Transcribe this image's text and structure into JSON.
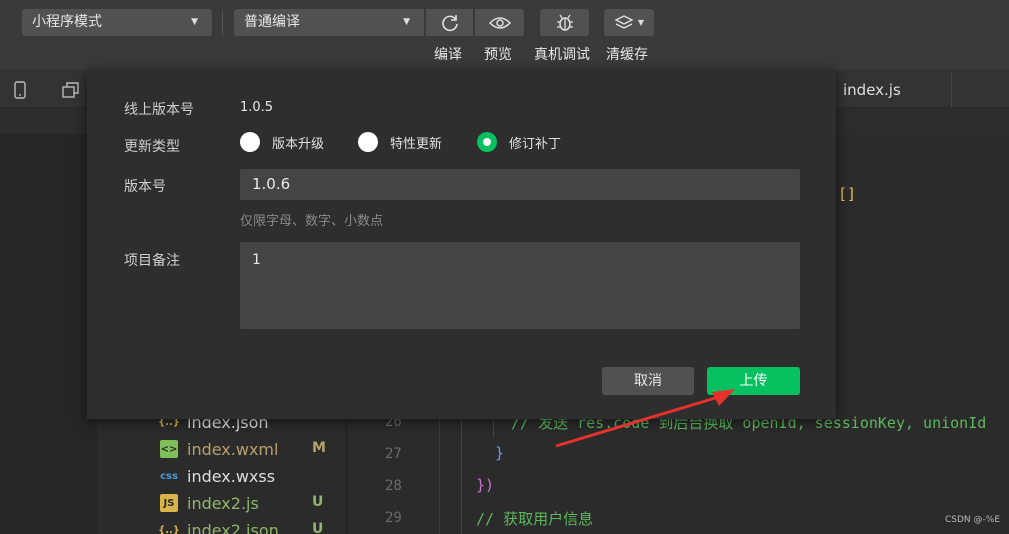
{
  "toolbar": {
    "mode_select": "小程序模式",
    "compile_select": "普通编译",
    "labels": {
      "compile": "编译",
      "preview": "预览",
      "debug": "真机调试",
      "clear_cache": "清缓存"
    }
  },
  "tabs": {
    "active_file": "index.js"
  },
  "dialog": {
    "online_version_label": "线上版本号",
    "online_version_value": "1.0.5",
    "update_type_label": "更新类型",
    "update_types": [
      {
        "label": "版本升级",
        "checked": false
      },
      {
        "label": "特性更新",
        "checked": false
      },
      {
        "label": "修订补丁",
        "checked": true
      }
    ],
    "version_label": "版本号",
    "version_value": "1.0.6",
    "version_hint": "仅限字母、数字、小数点",
    "note_label": "项目备注",
    "note_value": "1",
    "cancel_label": "取消",
    "upload_label": "上传"
  },
  "file_tree": [
    {
      "name": "index.json",
      "icon": "{..}",
      "status": ""
    },
    {
      "name": "index.wxml",
      "icon": "<>",
      "status": "M"
    },
    {
      "name": "index.wxss",
      "icon": "css",
      "status": ""
    },
    {
      "name": "index2.js",
      "icon": "JS",
      "status": "U"
    },
    {
      "name": "index2.json",
      "icon": "{..}",
      "status": "U"
    }
  ],
  "code": {
    "bracket_fragment": "[]",
    "lines": [
      {
        "number": "26",
        "text": "// 发送 res.code 到后台换取 openId, sessionKey, unionId"
      },
      {
        "number": "27",
        "text": "}"
      },
      {
        "number": "28",
        "text": "})"
      },
      {
        "number": "29",
        "text": "// 获取用户信息"
      }
    ]
  },
  "watermark": "CSDN @-%E",
  "colors": {
    "accent": "#07c160",
    "modified": "#b8a06a",
    "untracked": "#8fb66c",
    "code_comment": "#5cb85c"
  }
}
